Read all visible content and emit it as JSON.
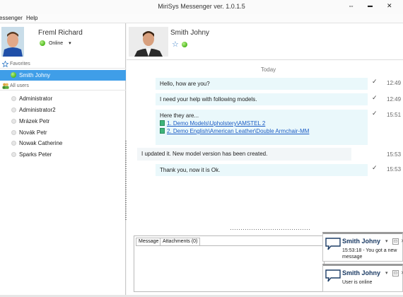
{
  "window": {
    "title": "MiriSys Messenger ver. 1.0.1.5",
    "ctrl_restore": "⇔",
    "ctrl_min": "▬",
    "ctrl_close": "✕"
  },
  "menu": {
    "items": [
      "essenger",
      "Help"
    ]
  },
  "me": {
    "name": "Freml Richard",
    "status": "Online",
    "status_arrow": "▾"
  },
  "favorites": {
    "header": "Favorites",
    "items": [
      "Smith Johny"
    ]
  },
  "all_users": {
    "header": "All users",
    "items": [
      "Administrator",
      "Administrator2",
      "Mrázek Petr",
      "Novák Petr",
      "Nowak Catherine",
      "Sparks Peter"
    ]
  },
  "contact": {
    "name": "Smith Johny",
    "star": "☆"
  },
  "chat": {
    "day_label": "Today",
    "check": "✓",
    "messages": [
      {
        "text": "Hello, how are you?",
        "time": "12:49",
        "outgoing": true
      },
      {
        "text": "I need your help with following models.",
        "time": "12:49",
        "outgoing": true
      },
      {
        "text": "Here they are...",
        "time": "15:51",
        "outgoing": true,
        "links": [
          "1. Demo Models\\Upholstery\\AMSTEL 2",
          "2. Demo English\\American Leather\\Double Armchair-MM"
        ]
      },
      {
        "text": "I updated it. New model version has been created.",
        "time": "15:53",
        "outgoing": false
      },
      {
        "text": "Thank you, now it is Ok.",
        "time": "15:53",
        "outgoing": true
      }
    ]
  },
  "compose": {
    "tab_message": "Message",
    "tab_attachments": "Attachments (0)"
  },
  "notifications": [
    {
      "name": "Smith Johny",
      "text": "15:53:18 - You got a new message"
    },
    {
      "name": "Smith Johny",
      "text": "User is online"
    }
  ],
  "colors": {
    "selection": "#3f9ee8",
    "bubble_out": "#eaf8fb",
    "link": "#1a5bc4",
    "online": "#4cb81c"
  }
}
